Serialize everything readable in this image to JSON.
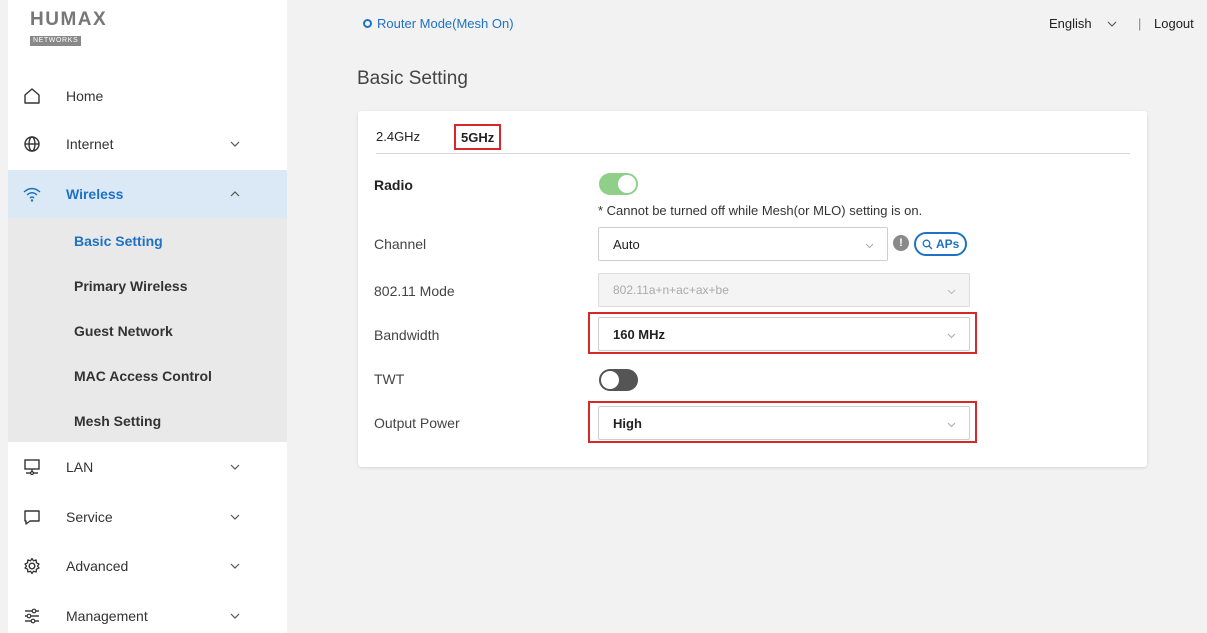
{
  "brand": {
    "logo_text": "HUMAX",
    "logo_sub": "NETWORKS"
  },
  "topbar": {
    "mode": "Router Mode(Mesh On)",
    "language": "English",
    "separator": "|",
    "logout": "Logout"
  },
  "sidebar": {
    "items": [
      {
        "label": "Home",
        "icon": "home-icon"
      },
      {
        "label": "Internet",
        "icon": "globe-icon"
      },
      {
        "label": "Wireless",
        "icon": "wifi-icon"
      },
      {
        "label": "LAN",
        "icon": "lan-icon"
      },
      {
        "label": "Service",
        "icon": "service-icon"
      },
      {
        "label": "Advanced",
        "icon": "gear-icon"
      },
      {
        "label": "Management",
        "icon": "sliders-icon"
      }
    ],
    "subitems": [
      {
        "label": "Basic Setting"
      },
      {
        "label": "Primary Wireless"
      },
      {
        "label": "Guest Network"
      },
      {
        "label": "MAC Access Control"
      },
      {
        "label": "Mesh Setting"
      }
    ]
  },
  "page": {
    "title": "Basic Setting"
  },
  "tabs": [
    {
      "label": "2.4GHz"
    },
    {
      "label": "5GHz"
    }
  ],
  "form": {
    "radio": {
      "label": "Radio",
      "enabled": true,
      "note": "* Cannot be turned off while Mesh(or MLO) setting is on."
    },
    "channel": {
      "label": "Channel",
      "value": "Auto",
      "aps_label": "APs",
      "info_glyph": "!"
    },
    "mode": {
      "label": "802.11 Mode",
      "value": "802.11a+n+ac+ax+be"
    },
    "bandwidth": {
      "label": "Bandwidth",
      "value": "160 MHz"
    },
    "twt": {
      "label": "TWT",
      "enabled": false
    },
    "output_power": {
      "label": "Output Power",
      "value": "High"
    }
  },
  "colors": {
    "accent": "#1d72c6",
    "highlight": "#d62828",
    "toggle_on": "#8fcf8a",
    "toggle_off": "#555555"
  }
}
